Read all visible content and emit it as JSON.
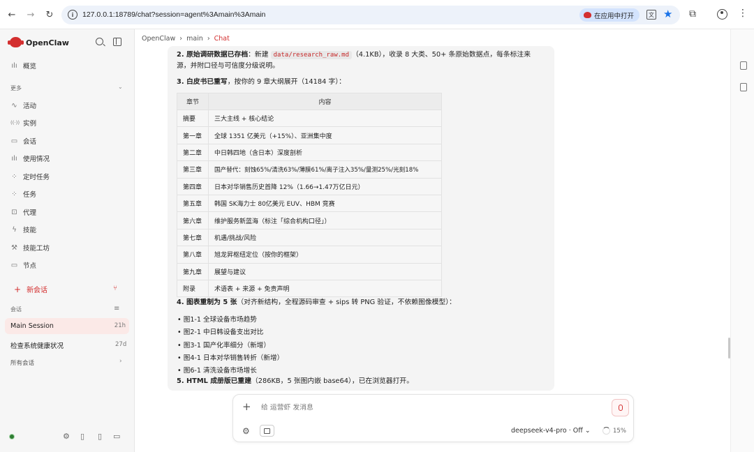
{
  "browser": {
    "url": "127.0.0.1:18789/chat?session=agent%3Amain%3Amain",
    "open_in_app": "在应用中打开",
    "translate_glyph": "文",
    "nav_back": "←",
    "nav_forward": "→",
    "nav_reload": "↻",
    "extensions_glyph": "⧉",
    "menu_glyph": "⋮",
    "star_glyph": "★"
  },
  "sidebar": {
    "brand": "OpenClaw",
    "overview": {
      "label": "概览",
      "icon": "chart-icon",
      "glyph": "ılı"
    },
    "more_header": "更多",
    "more_chevron": "⌄",
    "items": [
      {
        "label": "活动",
        "icon": "activity-icon",
        "glyph": "∿"
      },
      {
        "label": "实例",
        "icon": "broadcast-icon",
        "glyph": "((·))"
      },
      {
        "label": "会话",
        "icon": "file-icon",
        "glyph": "▭"
      },
      {
        "label": "使用情况",
        "icon": "bar-chart-icon",
        "glyph": "ılı"
      },
      {
        "label": "定时任务",
        "icon": "loader-icon",
        "glyph": "⁘"
      },
      {
        "label": "任务",
        "icon": "loader-icon",
        "glyph": "⁘"
      },
      {
        "label": "代理",
        "icon": "bot-icon",
        "glyph": "⊡"
      },
      {
        "label": "技能",
        "icon": "zap-icon",
        "glyph": "ϟ"
      },
      {
        "label": "技能工坊",
        "icon": "wrench-icon",
        "glyph": "⚒"
      },
      {
        "label": "节点",
        "icon": "monitor-icon",
        "glyph": "▭"
      }
    ],
    "new_chat": "新会话",
    "new_chat_plus": "+",
    "branch_glyph": "⑂",
    "sessions_header": "会话",
    "filter_glyph": "≡",
    "sessions": [
      {
        "name": "Main Session",
        "time": "21h"
      },
      {
        "name": "检查系统健康状况",
        "time": "27d"
      }
    ],
    "all_sessions": "所有会话",
    "all_sessions_chevron": "›",
    "footer_glyphs": {
      "settings": "⚙",
      "book": "▯",
      "tablet": "▯",
      "monitor": "▭"
    }
  },
  "breadcrumb": {
    "items": [
      "OpenClaw",
      "main",
      "Chat"
    ],
    "separator": "›"
  },
  "message": {
    "p2_title": "2. 原始调研数据已存档",
    "p2_pre": "：新建",
    "p2_code": "data/research_raw.md",
    "p2_post": "（4.1KB），收录 8 大类、50+ 条原始数据点，每条标注来",
    "p2_line2": "源，并附口径与可信度分级说明。",
    "p3_title": "3. 白皮书已重写",
    "p3_rest": "，按你的 9 章大纲展开（14184 字）：",
    "table": {
      "headers": [
        "章节",
        "内容"
      ],
      "rows": [
        [
          "摘要",
          "三大主线 + 核心结论"
        ],
        [
          "第一章",
          "全球 1351 亿美元（+15%）、亚洲集中度"
        ],
        [
          "第二章",
          "中日韩四地（含日本）深度剖析"
        ],
        [
          "第三章",
          "国产替代：刻蚀65%/清洗63%/薄膜61%/离子注入35%/量测25%/光刻18%"
        ],
        [
          "第四章",
          "日本对华销售历史首降 12%（1.66→1.47万亿日元）"
        ],
        [
          "第五章",
          "韩国 SK海力士 80亿美元 EUV、HBM 竞赛"
        ],
        [
          "第六章",
          "维护服务新蓝海（标注「综合机构口径」）"
        ],
        [
          "第七章",
          "机遇/挑战/风险"
        ],
        [
          "第八章",
          "旭龙昇枢纽定位（按你的框架）"
        ],
        [
          "第九章",
          "展望与建议"
        ],
        [
          "附录",
          "术语表 + 来源 + 免责声明"
        ]
      ]
    },
    "p4_title": "4. 图表重制为 5 张",
    "p4_rest": "（对齐新结构，全程源码审查 + sips 转 PNG 验证，不依赖图像模型）：",
    "charts": [
      "图1-1 全球设备市场趋势",
      "图2-1 中日韩设备支出对比",
      "图3-1 国产化率细分（新增）",
      "图4-1 日本对华销售转折（新增）",
      "图6-1 清洗设备市场增长"
    ],
    "bullet_glyph": "•",
    "p5_title": "5. HTML 成册版已重建",
    "p5_rest": "（286KB，5 张图内嵌 base64），已在浏览器打开。"
  },
  "composer": {
    "placeholder": "给 运营虾 发消息",
    "add_glyph": "+",
    "settings_glyph": "⚙",
    "model": "deepseek-v4-pro · Off ⌄",
    "context_percent": "15%"
  },
  "colors": {
    "accent": "#d32f2f",
    "link_blue": "#1a73e8",
    "status_green": "#2e7d32"
  }
}
